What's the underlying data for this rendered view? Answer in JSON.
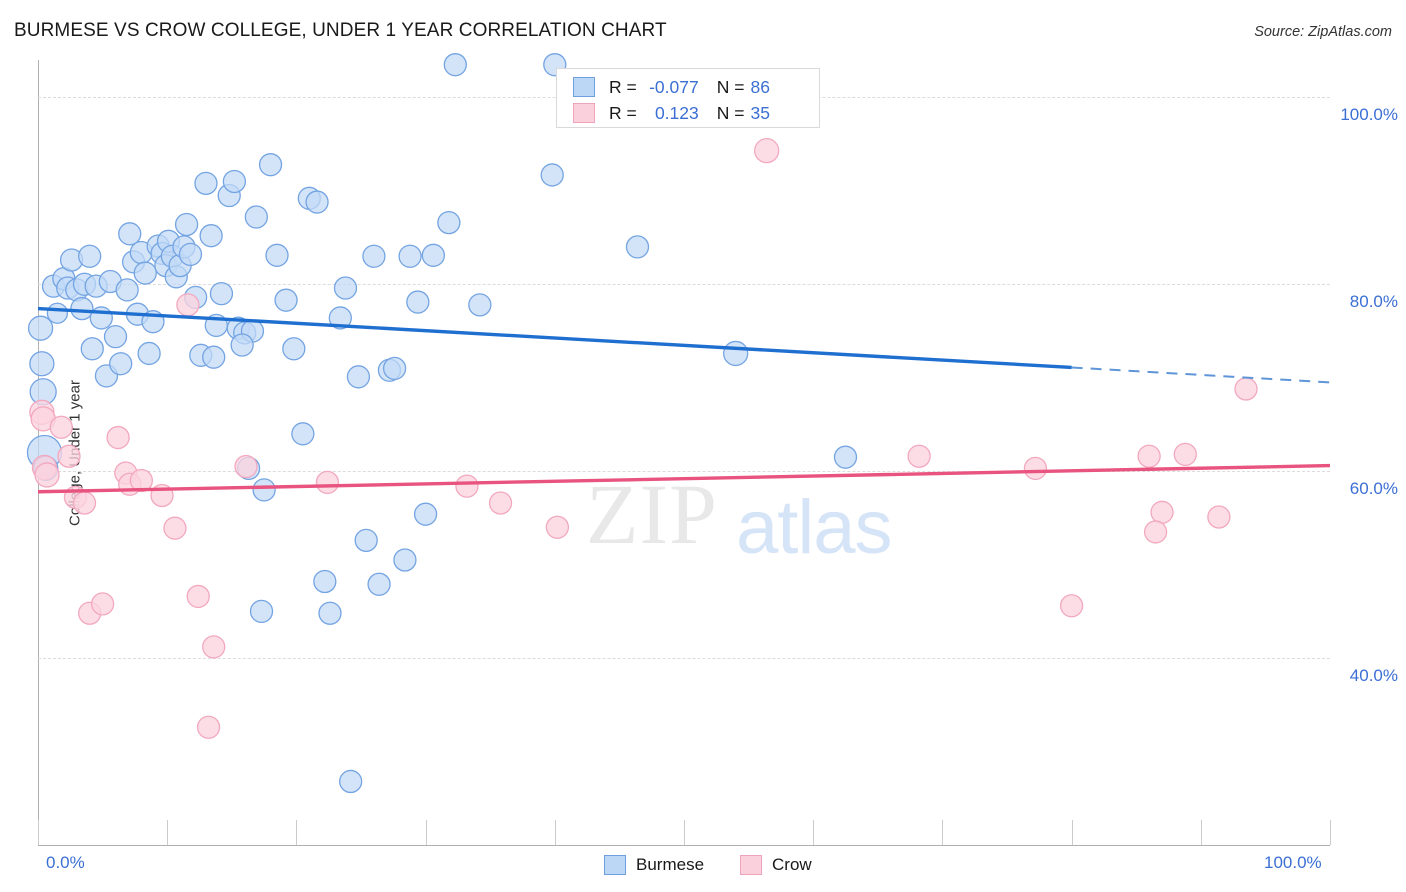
{
  "header": {
    "title": "BURMESE VS CROW COLLEGE, UNDER 1 YEAR CORRELATION CHART",
    "source": "Source: ZipAtlas.com"
  },
  "watermark": {
    "part1": "ZIP",
    "part2": "atlas"
  },
  "stats_legend": {
    "rows": [
      {
        "r_label": "R =",
        "r_value": "-0.077",
        "n_label": "N =",
        "n_value": "86",
        "color": "#bcd6f5"
      },
      {
        "r_label": "R =",
        "r_value": "0.123",
        "n_label": "N =",
        "n_value": "35",
        "color": "#fbd0dd"
      }
    ]
  },
  "bottom_legend": {
    "items": [
      {
        "label": "Burmese",
        "color": "#bcd6f5"
      },
      {
        "label": "Crow",
        "color": "#fbd0dd"
      }
    ]
  },
  "chart_data": {
    "type": "scatter",
    "title": "BURMESE VS CROW COLLEGE, UNDER 1 YEAR CORRELATION CHART",
    "xlabel": "",
    "ylabel": "College, Under 1 year",
    "xlim": [
      0,
      100
    ],
    "ylim": [
      20.0,
      104.0
    ],
    "grid": true,
    "legend_position": "bottom-center",
    "x_ticks": [
      {
        "value": 0,
        "label": "0.0%"
      },
      {
        "value": 10,
        "label": ""
      },
      {
        "value": 20,
        "label": ""
      },
      {
        "value": 30,
        "label": ""
      },
      {
        "value": 40,
        "label": ""
      },
      {
        "value": 50,
        "label": ""
      },
      {
        "value": 60,
        "label": ""
      },
      {
        "value": 70,
        "label": ""
      },
      {
        "value": 80,
        "label": ""
      },
      {
        "value": 90,
        "label": ""
      },
      {
        "value": 100,
        "label": "100.0%"
      }
    ],
    "y_ticks": [
      {
        "value": 100.0,
        "label": "100.0%"
      },
      {
        "value": 80.0,
        "label": "80.0%"
      },
      {
        "value": 60.0,
        "label": "60.0%"
      },
      {
        "value": 40.0,
        "label": "40.0%"
      }
    ],
    "series": [
      {
        "name": "Burmese",
        "color": "#c2d9f7",
        "stroke": "#74a4e2",
        "R": -0.077,
        "N": 86,
        "trendline": {
          "x0": 0,
          "y0": 77.4,
          "x1": 80,
          "y1": 71.1,
          "solid_to_x": 80,
          "x2": 100,
          "y2": 69.5
        },
        "points": [
          {
            "x": 0.2,
            "y": 75.3,
            "r": 12
          },
          {
            "x": 0.3,
            "y": 71.5,
            "r": 12
          },
          {
            "x": 0.4,
            "y": 68.5,
            "r": 13
          },
          {
            "x": 0.5,
            "y": 62.0,
            "r": 17
          },
          {
            "x": 0.6,
            "y": 60.3,
            "r": 12
          },
          {
            "x": 1.2,
            "y": 79.8,
            "r": 11
          },
          {
            "x": 1.5,
            "y": 76.9,
            "r": 10
          },
          {
            "x": 2.0,
            "y": 80.6,
            "r": 11
          },
          {
            "x": 2.3,
            "y": 79.6,
            "r": 11
          },
          {
            "x": 2.6,
            "y": 82.6,
            "r": 11
          },
          {
            "x": 3.0,
            "y": 79.4,
            "r": 11
          },
          {
            "x": 3.4,
            "y": 77.4,
            "r": 11
          },
          {
            "x": 3.6,
            "y": 80.0,
            "r": 11
          },
          {
            "x": 4.0,
            "y": 83.0,
            "r": 11
          },
          {
            "x": 4.2,
            "y": 73.1,
            "r": 11
          },
          {
            "x": 4.5,
            "y": 79.8,
            "r": 11
          },
          {
            "x": 4.9,
            "y": 76.4,
            "r": 11
          },
          {
            "x": 5.3,
            "y": 70.2,
            "r": 11
          },
          {
            "x": 5.6,
            "y": 80.3,
            "r": 11
          },
          {
            "x": 6.0,
            "y": 74.4,
            "r": 11
          },
          {
            "x": 6.4,
            "y": 71.5,
            "r": 11
          },
          {
            "x": 6.9,
            "y": 79.4,
            "r": 11
          },
          {
            "x": 7.1,
            "y": 85.4,
            "r": 11
          },
          {
            "x": 7.4,
            "y": 82.4,
            "r": 11
          },
          {
            "x": 7.7,
            "y": 76.8,
            "r": 11
          },
          {
            "x": 8.0,
            "y": 83.4,
            "r": 11
          },
          {
            "x": 8.3,
            "y": 81.2,
            "r": 11
          },
          {
            "x": 8.6,
            "y": 72.6,
            "r": 11
          },
          {
            "x": 8.9,
            "y": 76.0,
            "r": 11
          },
          {
            "x": 9.3,
            "y": 84.1,
            "r": 11
          },
          {
            "x": 9.6,
            "y": 83.3,
            "r": 11
          },
          {
            "x": 9.9,
            "y": 82.0,
            "r": 11
          },
          {
            "x": 10.1,
            "y": 84.6,
            "r": 11
          },
          {
            "x": 10.4,
            "y": 83.0,
            "r": 11
          },
          {
            "x": 10.7,
            "y": 80.8,
            "r": 11
          },
          {
            "x": 11.0,
            "y": 82.0,
            "r": 11
          },
          {
            "x": 11.3,
            "y": 84.0,
            "r": 11
          },
          {
            "x": 11.5,
            "y": 86.4,
            "r": 11
          },
          {
            "x": 11.8,
            "y": 83.2,
            "r": 11
          },
          {
            "x": 12.2,
            "y": 78.6,
            "r": 11
          },
          {
            "x": 12.6,
            "y": 72.4,
            "r": 11
          },
          {
            "x": 13.0,
            "y": 90.8,
            "r": 11
          },
          {
            "x": 13.4,
            "y": 85.2,
            "r": 11
          },
          {
            "x": 13.8,
            "y": 75.6,
            "r": 11
          },
          {
            "x": 14.2,
            "y": 79.0,
            "r": 11
          },
          {
            "x": 14.8,
            "y": 89.5,
            "r": 11
          },
          {
            "x": 15.2,
            "y": 91.0,
            "r": 11
          },
          {
            "x": 15.5,
            "y": 75.3,
            "r": 11
          },
          {
            "x": 16.0,
            "y": 74.8,
            "r": 11
          },
          {
            "x": 16.3,
            "y": 60.3,
            "r": 11
          },
          {
            "x": 16.6,
            "y": 75.0,
            "r": 11
          },
          {
            "x": 16.9,
            "y": 87.2,
            "r": 11
          },
          {
            "x": 17.3,
            "y": 45.0,
            "r": 11
          },
          {
            "x": 17.5,
            "y": 58.0,
            "r": 11
          },
          {
            "x": 18.0,
            "y": 92.8,
            "r": 11
          },
          {
            "x": 18.5,
            "y": 83.1,
            "r": 11
          },
          {
            "x": 19.2,
            "y": 78.3,
            "r": 11
          },
          {
            "x": 19.8,
            "y": 73.1,
            "r": 11
          },
          {
            "x": 20.5,
            "y": 64.0,
            "r": 11
          },
          {
            "x": 21.0,
            "y": 89.2,
            "r": 11
          },
          {
            "x": 21.6,
            "y": 88.8,
            "r": 11
          },
          {
            "x": 22.2,
            "y": 48.2,
            "r": 11
          },
          {
            "x": 22.6,
            "y": 44.8,
            "r": 11
          },
          {
            "x": 23.4,
            "y": 76.4,
            "r": 11
          },
          {
            "x": 23.8,
            "y": 79.6,
            "r": 11
          },
          {
            "x": 24.2,
            "y": 26.8,
            "r": 11
          },
          {
            "x": 24.8,
            "y": 70.1,
            "r": 11
          },
          {
            "x": 25.4,
            "y": 52.6,
            "r": 11
          },
          {
            "x": 26.0,
            "y": 83.0,
            "r": 11
          },
          {
            "x": 26.4,
            "y": 47.9,
            "r": 11
          },
          {
            "x": 27.2,
            "y": 70.8,
            "r": 11
          },
          {
            "x": 27.6,
            "y": 71.0,
            "r": 11
          },
          {
            "x": 28.4,
            "y": 50.5,
            "r": 11
          },
          {
            "x": 28.8,
            "y": 83.0,
            "r": 11
          },
          {
            "x": 29.4,
            "y": 78.1,
            "r": 11
          },
          {
            "x": 30.0,
            "y": 55.4,
            "r": 11
          },
          {
            "x": 30.6,
            "y": 83.1,
            "r": 11
          },
          {
            "x": 32.3,
            "y": 103.5,
            "r": 11
          },
          {
            "x": 31.8,
            "y": 86.6,
            "r": 11
          },
          {
            "x": 34.2,
            "y": 77.8,
            "r": 11
          },
          {
            "x": 39.8,
            "y": 91.7,
            "r": 11
          },
          {
            "x": 40.0,
            "y": 103.5,
            "r": 11
          },
          {
            "x": 46.4,
            "y": 84.0,
            "r": 11
          },
          {
            "x": 54.0,
            "y": 72.6,
            "r": 12
          },
          {
            "x": 62.5,
            "y": 61.5,
            "r": 11
          },
          {
            "x": 13.6,
            "y": 72.2,
            "r": 11
          },
          {
            "x": 15.8,
            "y": 73.5,
            "r": 11
          }
        ]
      },
      {
        "name": "Crow",
        "color": "#fbd3df",
        "stroke": "#f2a8bf",
        "R": 0.123,
        "N": 35,
        "trendline": {
          "x0": 0,
          "y0": 57.8,
          "x1": 100,
          "y1": 60.6,
          "solid_to_x": 100
        },
        "points": [
          {
            "x": 0.3,
            "y": 66.3,
            "r": 12
          },
          {
            "x": 0.4,
            "y": 65.6,
            "r": 12
          },
          {
            "x": 0.5,
            "y": 60.4,
            "r": 12
          },
          {
            "x": 0.7,
            "y": 59.6,
            "r": 12
          },
          {
            "x": 1.8,
            "y": 64.7,
            "r": 11
          },
          {
            "x": 2.4,
            "y": 61.6,
            "r": 11
          },
          {
            "x": 2.9,
            "y": 57.2,
            "r": 11
          },
          {
            "x": 3.6,
            "y": 56.6,
            "r": 11
          },
          {
            "x": 4.0,
            "y": 44.8,
            "r": 11
          },
          {
            "x": 5.0,
            "y": 45.8,
            "r": 11
          },
          {
            "x": 6.2,
            "y": 63.6,
            "r": 11
          },
          {
            "x": 6.8,
            "y": 59.8,
            "r": 11
          },
          {
            "x": 7.1,
            "y": 58.6,
            "r": 11
          },
          {
            "x": 8.0,
            "y": 59.0,
            "r": 11
          },
          {
            "x": 9.6,
            "y": 57.4,
            "r": 11
          },
          {
            "x": 10.6,
            "y": 53.9,
            "r": 11
          },
          {
            "x": 11.6,
            "y": 77.8,
            "r": 11
          },
          {
            "x": 12.4,
            "y": 46.6,
            "r": 11
          },
          {
            "x": 13.6,
            "y": 41.2,
            "r": 11
          },
          {
            "x": 13.2,
            "y": 32.6,
            "r": 11
          },
          {
            "x": 16.1,
            "y": 60.5,
            "r": 11
          },
          {
            "x": 22.4,
            "y": 58.8,
            "r": 11
          },
          {
            "x": 33.2,
            "y": 58.4,
            "r": 11
          },
          {
            "x": 35.8,
            "y": 56.6,
            "r": 11
          },
          {
            "x": 40.2,
            "y": 54.0,
            "r": 11
          },
          {
            "x": 56.4,
            "y": 94.3,
            "r": 12
          },
          {
            "x": 68.2,
            "y": 61.6,
            "r": 11
          },
          {
            "x": 77.2,
            "y": 60.3,
            "r": 11
          },
          {
            "x": 80.0,
            "y": 45.6,
            "r": 11
          },
          {
            "x": 86.0,
            "y": 61.6,
            "r": 11
          },
          {
            "x": 88.8,
            "y": 61.8,
            "r": 11
          },
          {
            "x": 87.0,
            "y": 55.6,
            "r": 11
          },
          {
            "x": 86.5,
            "y": 53.5,
            "r": 11
          },
          {
            "x": 91.4,
            "y": 55.1,
            "r": 11
          },
          {
            "x": 93.5,
            "y": 68.8,
            "r": 11
          }
        ]
      }
    ]
  }
}
